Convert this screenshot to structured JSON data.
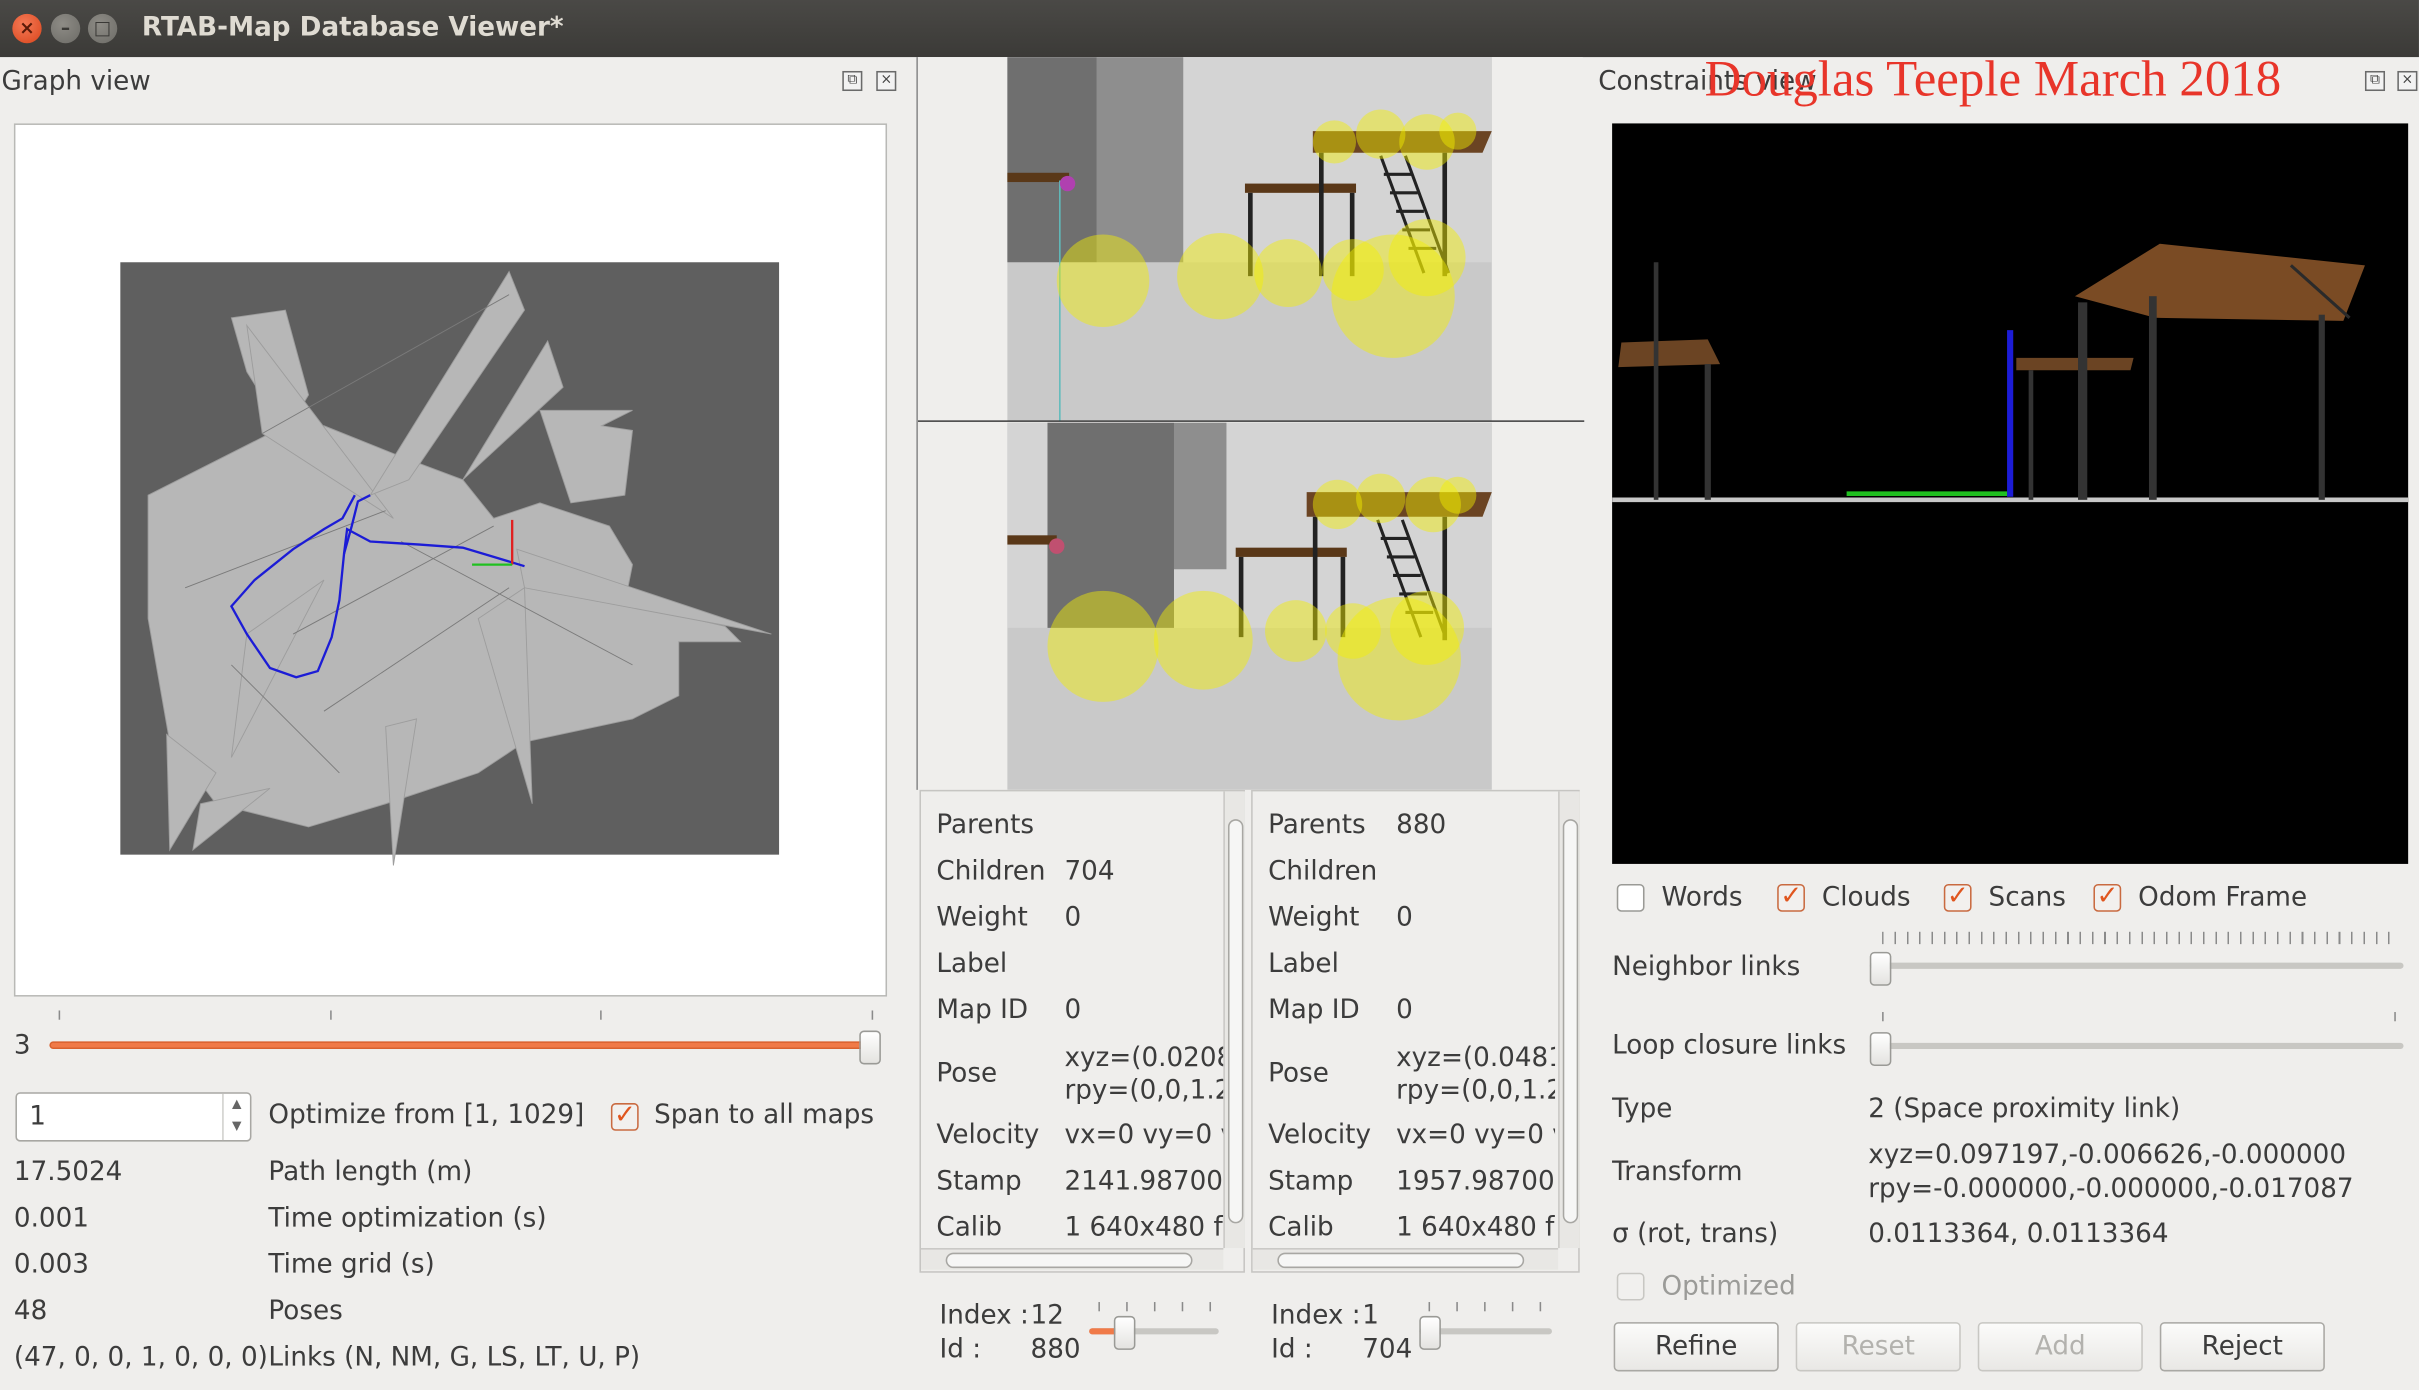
{
  "window": {
    "title": "RTAB-Map Database Viewer*"
  },
  "graph_view": {
    "title": "Graph view",
    "slider_value": "3",
    "optimize_input": "1",
    "optimize_label": "Optimize from [1, 1029]",
    "span_label": "Span to all maps",
    "stats": [
      {
        "value": "17.5024",
        "label": "Path length (m)"
      },
      {
        "value": "0.001",
        "label": "Time optimization (s)"
      },
      {
        "value": "0.003",
        "label": "Time grid (s)"
      },
      {
        "value": "48",
        "label": "Poses"
      },
      {
        "value": "(47, 0, 0, 1, 0, 0, 0)",
        "label": "Links (N, NM, G, LS, LT, U, P)"
      }
    ]
  },
  "node_a": {
    "rows": [
      {
        "key": "Parents",
        "value": ""
      },
      {
        "key": "Children",
        "value": "704"
      },
      {
        "key": "Weight",
        "value": "0"
      },
      {
        "key": "Label",
        "value": ""
      },
      {
        "key": "Map ID",
        "value": "0"
      },
      {
        "key": "Pose",
        "value": "xyz=(0.0208",
        "value2": "rpy=(0,0,1.2"
      },
      {
        "key": "Velocity",
        "value": "vx=0 vy=0 v"
      },
      {
        "key": "Stamp",
        "value": "2141.98700"
      },
      {
        "key": "Calib",
        "value": "1 640x480 f"
      }
    ],
    "index_label": "Index :",
    "index_value": "12",
    "id_label": "Id :",
    "id_value": "880"
  },
  "node_b": {
    "rows": [
      {
        "key": "Parents",
        "value": "880"
      },
      {
        "key": "Children",
        "value": ""
      },
      {
        "key": "Weight",
        "value": "0"
      },
      {
        "key": "Label",
        "value": ""
      },
      {
        "key": "Map ID",
        "value": "0"
      },
      {
        "key": "Pose",
        "value": "xyz=(0.0481",
        "value2": "rpy=(0,0,1.2"
      },
      {
        "key": "Velocity",
        "value": "vx=0 vy=0 v"
      },
      {
        "key": "Stamp",
        "value": "1957.98700"
      },
      {
        "key": "Calib",
        "value": "1 640x480 f"
      }
    ],
    "index_label": "Index :",
    "index_value": "1",
    "id_label": "Id :",
    "id_value": "704"
  },
  "constraints_view": {
    "title": "Constraints view",
    "watermark": "Douglas Teeple March 2018",
    "checkboxes": {
      "words": "Words",
      "clouds": "Clouds",
      "scans": "Scans",
      "odom": "Odom Frame"
    },
    "neighbor_label": "Neighbor links",
    "loop_label": "Loop closure links",
    "type_label": "Type",
    "type_value": "2 (Space proximity link)",
    "transform_label": "Transform",
    "transform_xyz": "xyz=0.097197,-0.006626,-0.000000",
    "transform_rpy": "rpy=-0.000000,-0.000000,-0.017087",
    "sigma_label": "σ (rot, trans)",
    "sigma_value": "0.0113364, 0.0113364",
    "optimized_label": "Optimized",
    "buttons": {
      "refine": "Refine",
      "reset": "Reset",
      "add": "Add",
      "reject": "Reject"
    }
  },
  "colors": {
    "accent": "#e0561f",
    "path": "#1c1cd6",
    "map_bg": "#5f5f5f",
    "map_free": "#b4b4b4"
  }
}
